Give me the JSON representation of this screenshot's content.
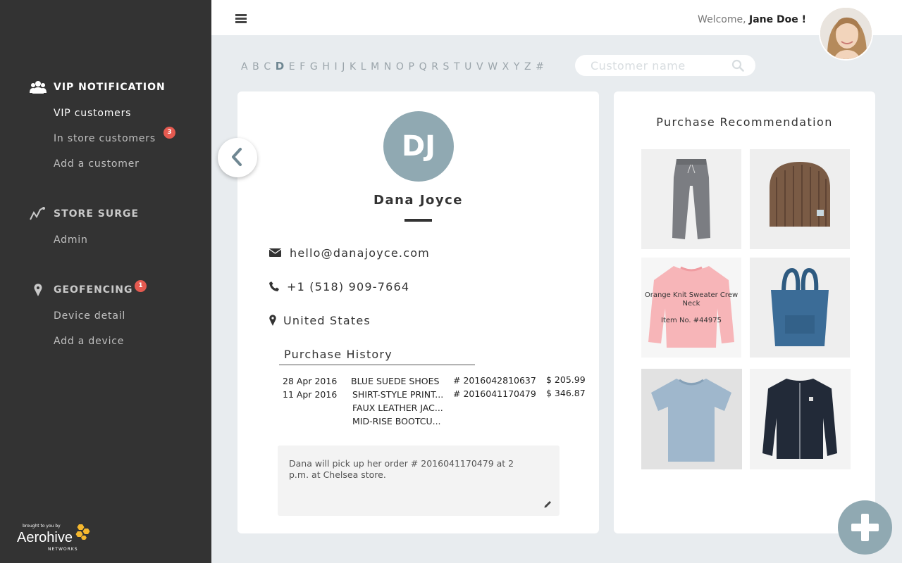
{
  "sidebar": {
    "sections": [
      {
        "label": "VIP NOTIFICATION",
        "icon": "users-icon",
        "items": [
          "VIP customers",
          "In store customers",
          "Add a customer"
        ],
        "badge": "3"
      },
      {
        "label": "STORE SURGE",
        "icon": "chart-line-icon",
        "items": [
          "Admin"
        ]
      },
      {
        "label": "GEOFENCING",
        "icon": "map-pin-icon",
        "items": [
          "Device detail",
          "Add a device"
        ],
        "badge": "1"
      }
    ],
    "brand": {
      "tagline": "brought to you by",
      "name": "Aerohive",
      "sub": "NETWORKS"
    }
  },
  "header": {
    "welcome_prefix": "Welcome,",
    "user_name": "Jane Doe !"
  },
  "alphabet": [
    "A",
    "B",
    "C",
    "D",
    "E",
    "F",
    "G",
    "H",
    "I",
    "J",
    "K",
    "L",
    "M",
    "N",
    "O",
    "P",
    "Q",
    "R",
    "S",
    "T",
    "U",
    "V",
    "W",
    "X",
    "Y",
    "Z",
    "#"
  ],
  "alphabet_selected": "D",
  "search": {
    "placeholder": "Customer name"
  },
  "profile": {
    "initials": "DJ",
    "name": "Dana Joyce",
    "email": "hello@danajoyce.com",
    "phone": "+1 (518) 909-7664",
    "location": "United States",
    "history_title": "Purchase History",
    "history": [
      {
        "date": "28 Apr 2016",
        "items": [
          "BLUE SUEDE SHOES"
        ],
        "order": "# 2016042810637",
        "total": "$ 205.99"
      },
      {
        "date": "11 Apr 2016",
        "items": [
          "SHIRT-STYLE PRINT...",
          "FAUX LEATHER JAC...",
          "MID-RISE BOOTCU..."
        ],
        "order": "# 2016041170479",
        "total": "$ 346.87"
      }
    ],
    "note": "Dana will pick up her order # 2016041170479 at 2 p.m. at Chelsea store."
  },
  "recommendation": {
    "title": "Purchase Recommendation",
    "products": [
      {
        "icon": "sweatpants-image"
      },
      {
        "icon": "beanie-image"
      },
      {
        "icon": "sweater-image",
        "name": "Orange Knit Sweater Crew Neck",
        "item_no": "Item No. #44975"
      },
      {
        "icon": "tote-bag-image"
      },
      {
        "icon": "tshirt-image"
      },
      {
        "icon": "jacket-image"
      }
    ]
  },
  "colors": {
    "sidebar": "#333333",
    "accent": "#90a9b2",
    "badge": "#e55a50",
    "background": "#e8ecef"
  }
}
